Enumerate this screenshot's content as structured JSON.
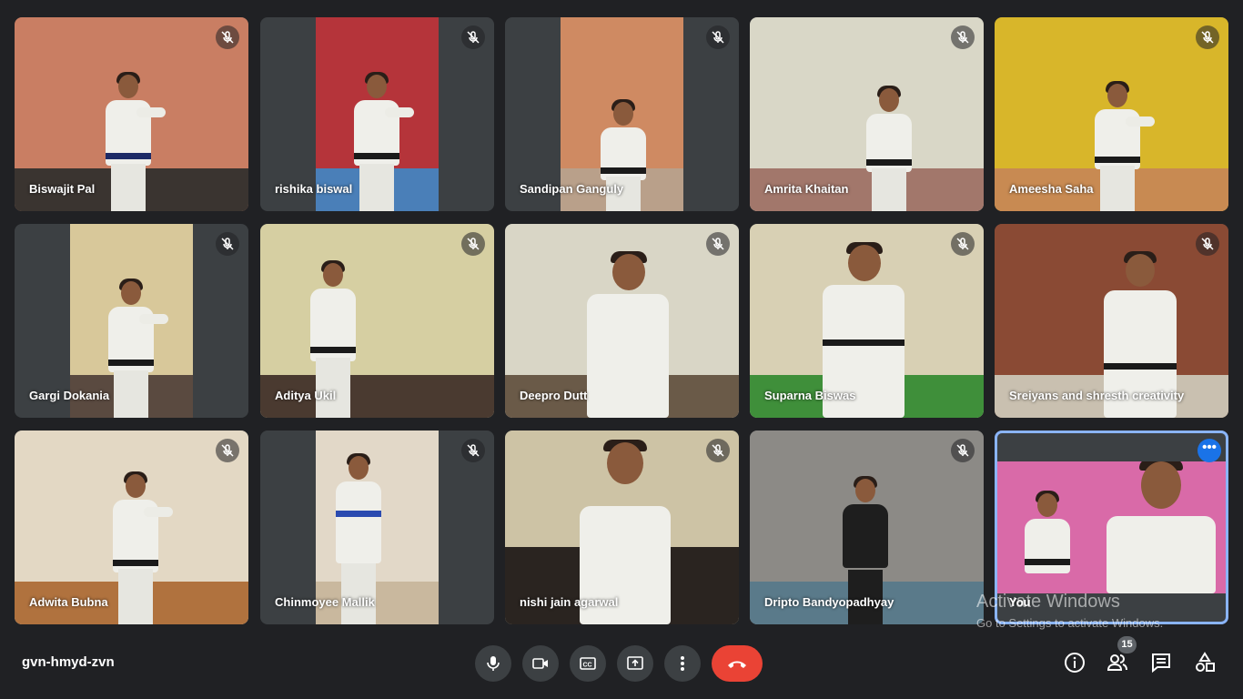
{
  "participants": [
    "Biswajit Pal",
    "rishika biswal",
    "Sandipan Ganguly",
    "Amrita Khaitan",
    "Ameesha Saha",
    "Gargi Dokania",
    "Aditya Ukil",
    "Deepro Dutt",
    "Suparna Biswas",
    "Sreiyans and shresth creativity",
    "Adwita Bubna",
    "Chinmoyee Mallik",
    "nishi jain agarwal",
    "Dripto Bandyopadhyay",
    "You"
  ],
  "meeting_code": "gvn-hmyd-zvn",
  "people_count": "15",
  "watermark": {
    "title": "Activate Windows",
    "subtitle": "Go to Settings to activate Windows."
  },
  "icons": {
    "tile_status": "mic-off-icon",
    "self_menu": "more-options-icon",
    "controls": [
      "microphone-icon",
      "camera-icon",
      "captions-icon",
      "present-screen-icon",
      "more-vert-icon",
      "hang-up-icon"
    ],
    "right": [
      "info-icon",
      "people-icon",
      "chat-icon",
      "activities-icon"
    ]
  },
  "colors": {
    "background": "#202124",
    "tile": "#3c4043",
    "hangup": "#ea4335",
    "accent": "#1a73e8",
    "self_outline": "#8ab4f8"
  }
}
